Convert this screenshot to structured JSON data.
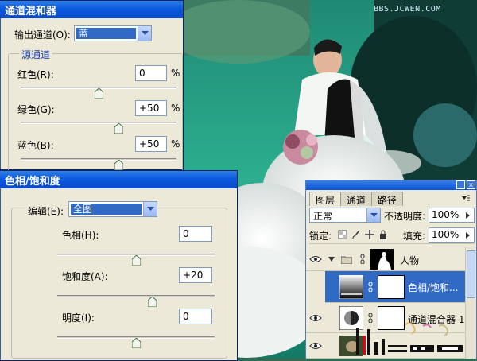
{
  "watermark_top": "BBS.JCWEN.COM",
  "channel_mixer": {
    "title": "通道混和器",
    "output_label": "输出通道(O):",
    "output_value": "蓝",
    "source_group": "源通道",
    "red_label": "红色(R):",
    "red_value": "0",
    "red_level": 0,
    "green_label": "绿色(G):",
    "green_value": "+50",
    "green_level": 50,
    "blue_label": "蓝色(B):",
    "blue_value": "+50",
    "blue_level": 50,
    "percent": "%"
  },
  "hue_sat": {
    "title": "色相/饱和度",
    "edit_label": "编辑(E):",
    "edit_value": "全图",
    "hue_label": "色相(H):",
    "hue_value": "0",
    "hue_level": 0,
    "sat_label": "饱和度(A):",
    "sat_value": "+20",
    "sat_level": 20,
    "light_label": "明度(I):",
    "light_value": "0",
    "light_level": 0
  },
  "layers": {
    "tabs": [
      "图层",
      "通道",
      "路径"
    ],
    "blend_mode": "正常",
    "opacity_label": "不透明度:",
    "opacity_value": "100%",
    "lock_label": "锁定:",
    "fill_label": "填充:",
    "fill_value": "100%",
    "items": [
      {
        "name": "人物",
        "type": "group"
      },
      {
        "name": "色相/饱和...",
        "type": "adjustment",
        "selected": true
      },
      {
        "name": "通道混合器 1",
        "type": "adjustment"
      },
      {
        "name": "",
        "type": "image"
      }
    ]
  },
  "colors": {
    "title_blue": "#0b5ae0",
    "selection": "#316ac5",
    "dialog_bg": "#ece9d8"
  }
}
